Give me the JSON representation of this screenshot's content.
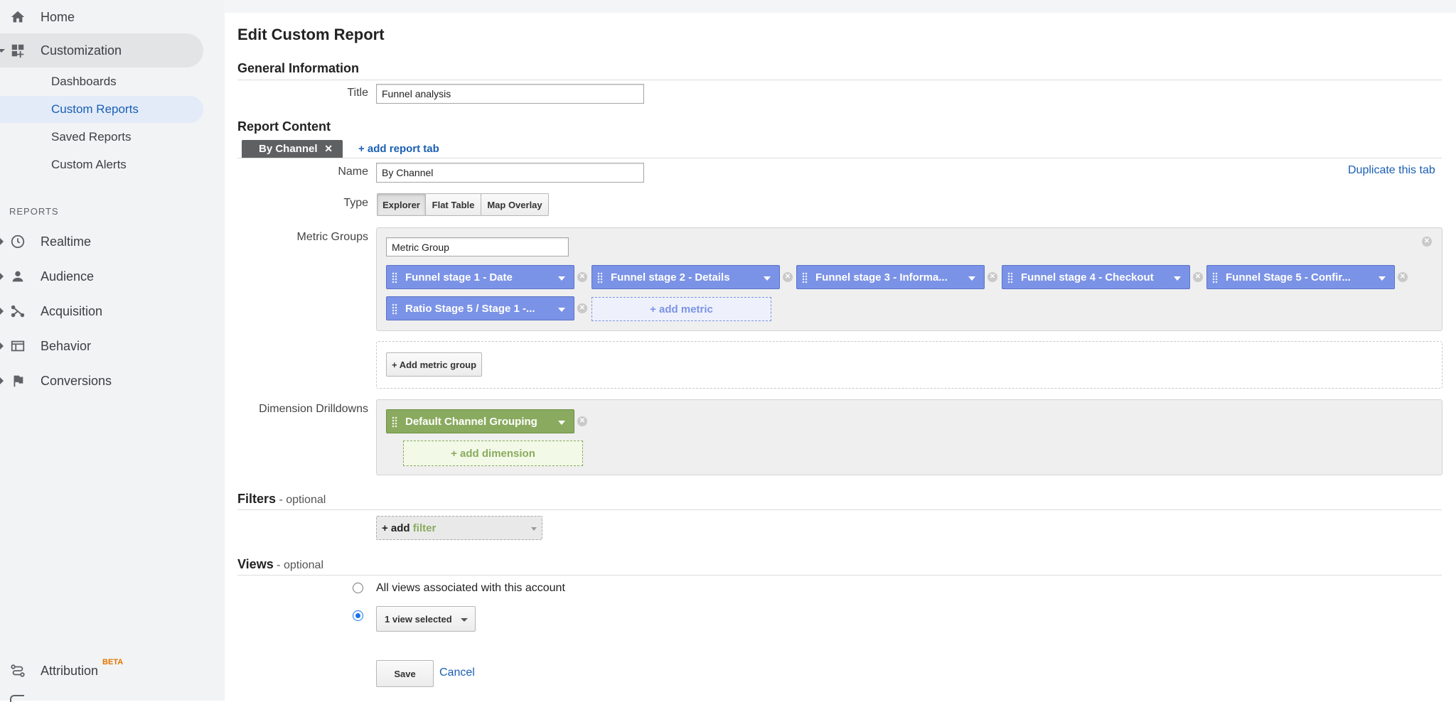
{
  "sidebar": {
    "home": "Home",
    "customization": "Customization",
    "sub_items": [
      "Dashboards",
      "Custom Reports",
      "Saved Reports",
      "Custom Alerts"
    ],
    "reports_section": "REPORTS",
    "reports": [
      "Realtime",
      "Audience",
      "Acquisition",
      "Behavior",
      "Conversions"
    ],
    "attribution": "Attribution",
    "attribution_badge": "BETA"
  },
  "page": {
    "title": "Edit Custom Report",
    "general_info": "General Information",
    "title_label": "Title",
    "title_value": "Funnel analysis",
    "report_content": "Report Content",
    "tab_name": "By Channel",
    "add_tab": "+ add report tab",
    "name_label": "Name",
    "name_value": "By Channel",
    "duplicate": "Duplicate this tab",
    "type_label": "Type",
    "types": [
      "Explorer",
      "Flat Table",
      "Map Overlay"
    ],
    "metric_groups_label": "Metric Groups",
    "metric_group_name": "Metric Group",
    "metrics": [
      "Funnel stage 1 - Date",
      "Funnel stage 2 - Details",
      "Funnel stage 3 - Informa...",
      "Funnel stage 4 - Checkout",
      "Funnel Stage 5 - Confir...",
      "Ratio Stage 5 / Stage 1 -..."
    ],
    "add_metric": "+ add metric",
    "add_metric_group": "+ Add metric group",
    "dimension_label": "Dimension Drilldowns",
    "dimension": "Default Channel Grouping",
    "add_dimension": "+ add dimension",
    "filters": "Filters",
    "optional": "- optional",
    "add_filter_plus": "+ add",
    "add_filter_word": "filter",
    "views": "Views",
    "all_views": "All views associated with this account",
    "view_selected": "1 view selected",
    "save": "Save",
    "cancel": "Cancel"
  },
  "colors": {
    "metric_chip": "#7b93e6",
    "dimension_chip": "#8aab5f",
    "link": "#1a5fb4",
    "active_nav_bg": "#e3ebf8"
  }
}
